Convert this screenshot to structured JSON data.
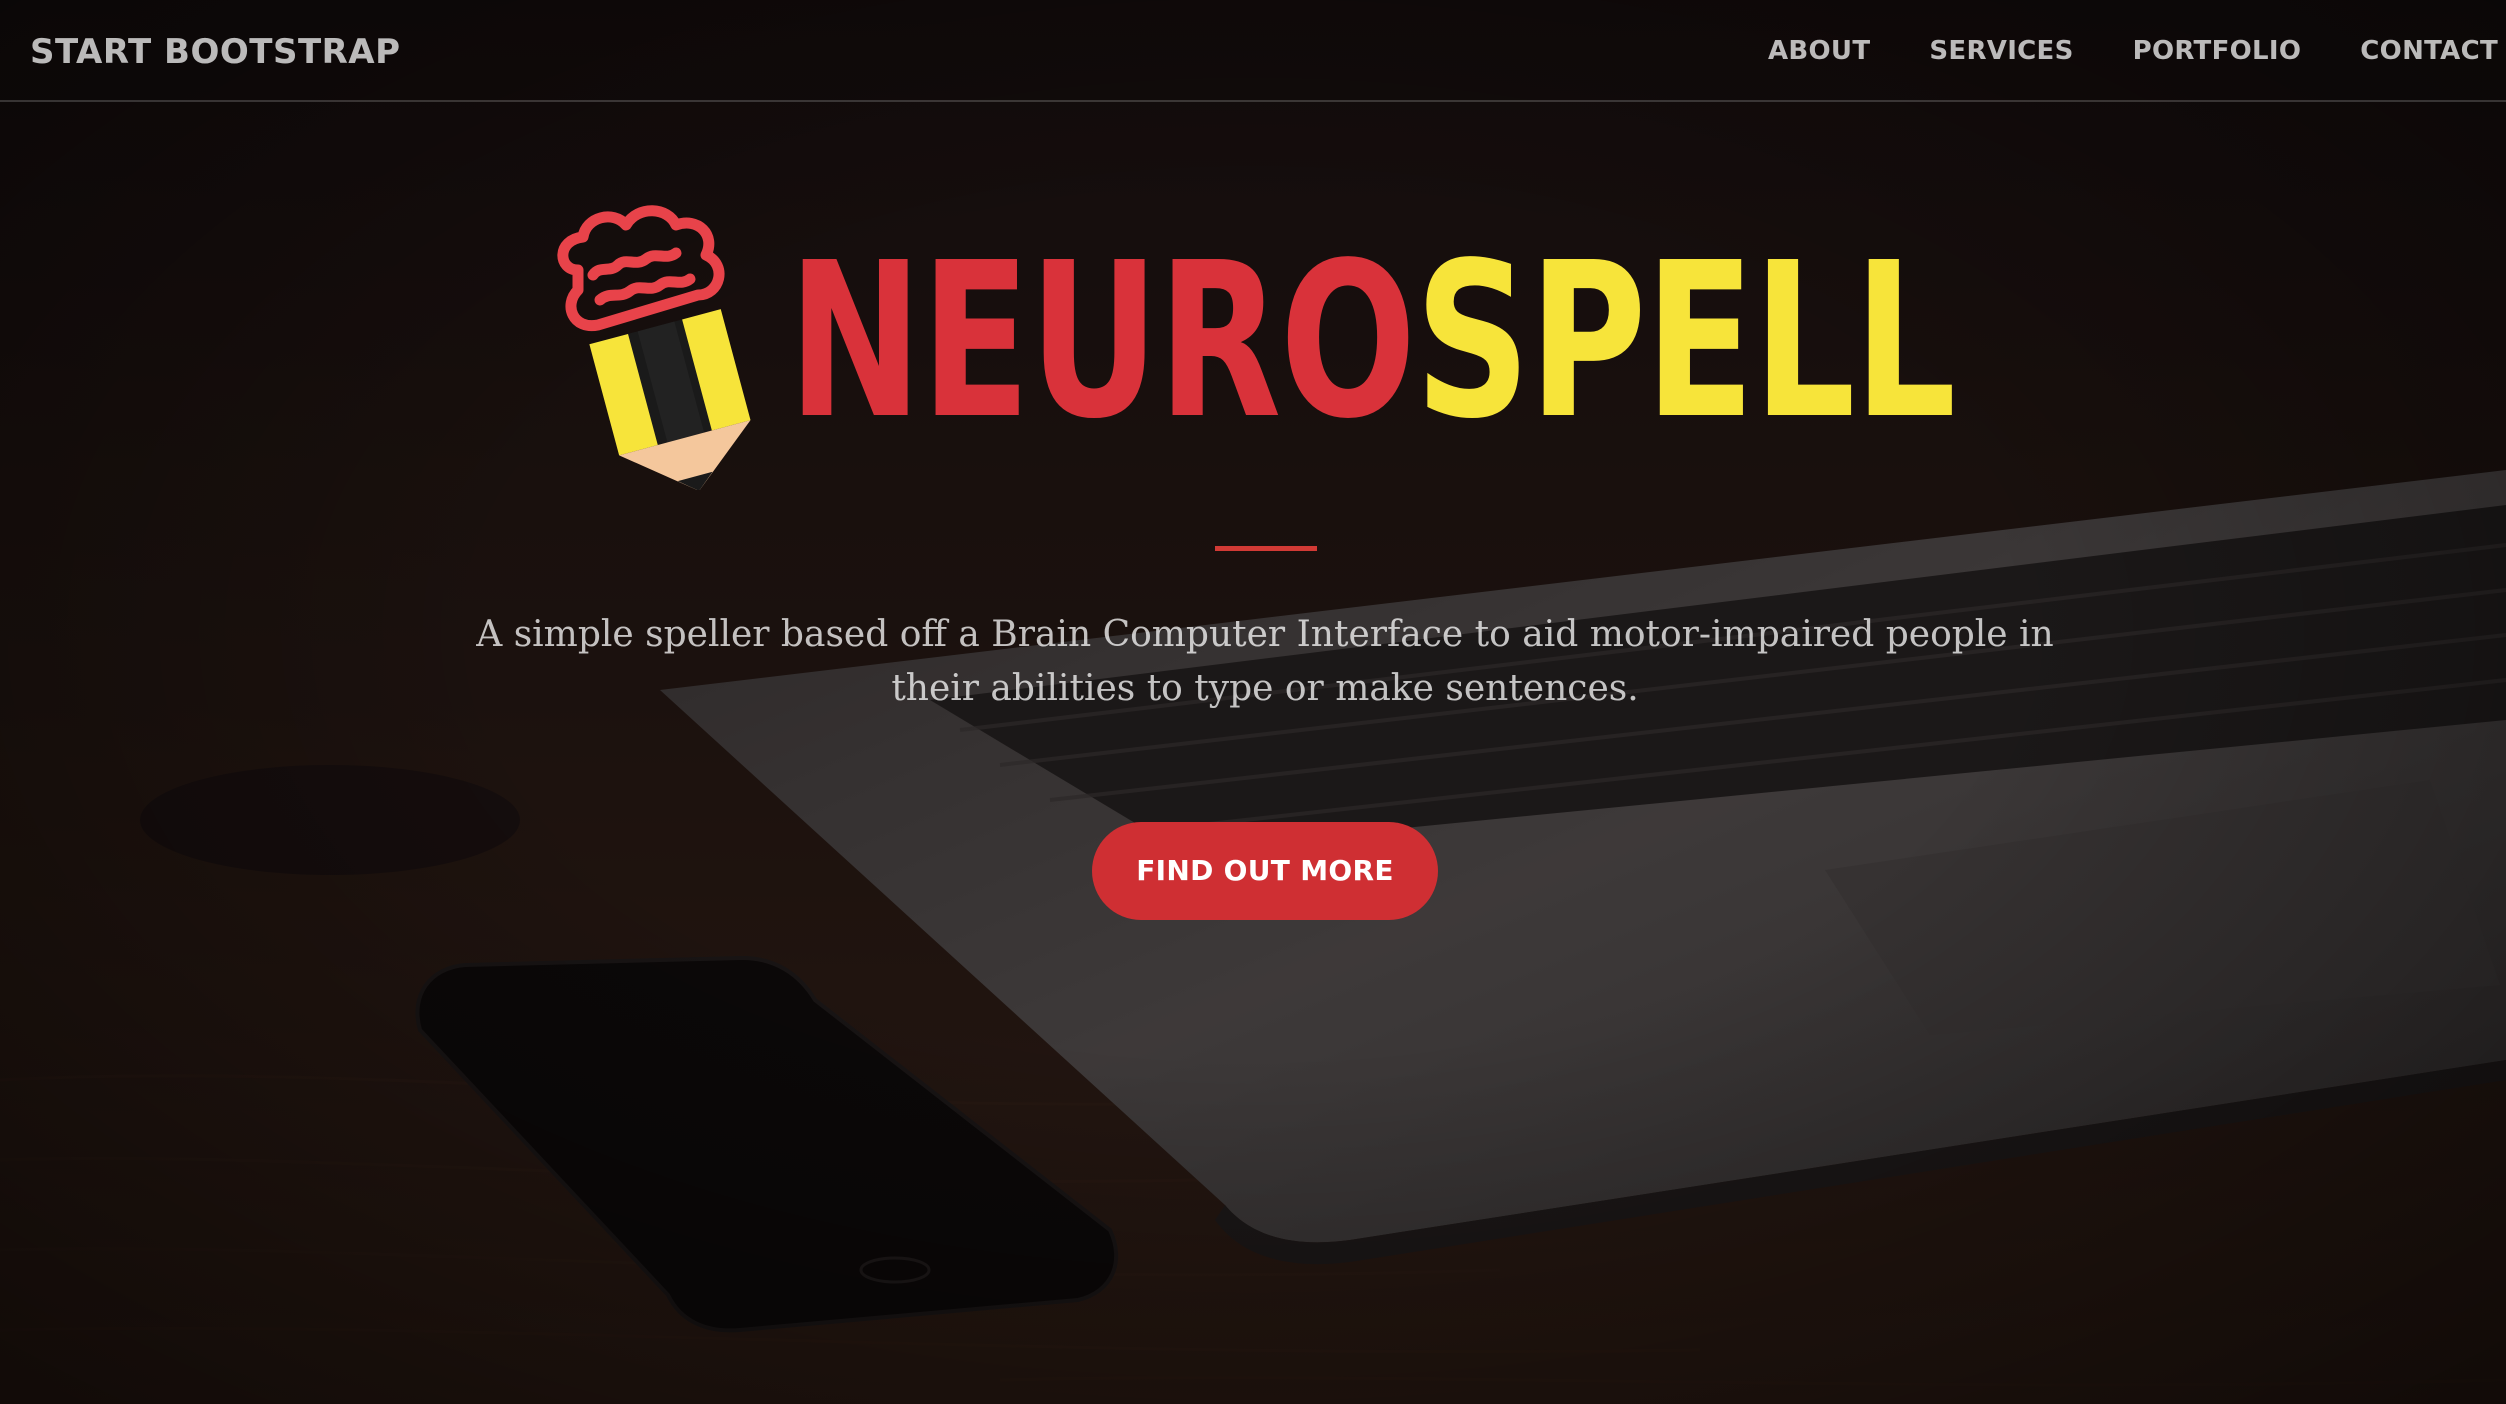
{
  "navbar": {
    "brand": "START BOOTSTRAP",
    "links": [
      "ABOUT",
      "SERVICES",
      "PORTFOLIO",
      "CONTACT"
    ]
  },
  "hero": {
    "logo": {
      "word_red": "NEURO",
      "word_yellow": "SPELL",
      "icon": "brain-pencil-icon"
    },
    "subtitle": "A simple speller based off a Brain Computer Interface to aid motor-impaired people in their abilities to type or make sentences.",
    "cta_label": "FIND OUT MORE"
  },
  "colors": {
    "accent_red": "#cf2f33",
    "accent_yellow": "#f7e43a",
    "overlay": "#140f0f"
  }
}
